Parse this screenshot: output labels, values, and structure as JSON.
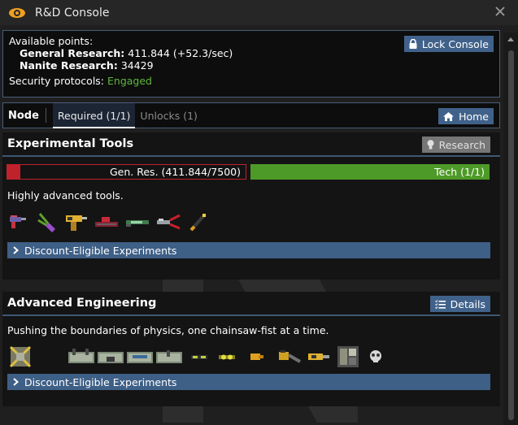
{
  "window": {
    "title": "R&D Console"
  },
  "points": {
    "available_label": "Available points:",
    "general_label": "General Research:",
    "general_value": "411.844 (+52.3/sec)",
    "nanite_label": "Nanite Research:",
    "nanite_value": "34429",
    "security_label": "Security protocols:",
    "security_value": "Engaged",
    "lock_button": "Lock Console"
  },
  "tabs": {
    "node_label": "Node",
    "required": "Required (1/1)",
    "unlocks": "Unlocks (1)",
    "home_button": "Home"
  },
  "nodes": [
    {
      "name": "Experimental Tools",
      "button": "Research",
      "gen_bar_label": "Gen. Res. (411.844/7500)",
      "gen_progress": 0.055,
      "tech_bar_label": "Tech (1/1)",
      "tech_progress": 1.0,
      "description": "Highly advanced tools.",
      "experiments": "Discount-Eligible Experiments",
      "item_icons": [
        "rcd-gun-icon",
        "wirecutter-icon",
        "power-drill-icon",
        "rapid-pipe-dispenser-icon",
        "plasma-cutter-icon",
        "jaws-of-life-icon",
        "welding-tool-icon"
      ]
    },
    {
      "name": "Advanced Engineering",
      "button": "Details",
      "description": "Pushing the boundaries of physics, one chainsaw-fist at a time.",
      "experiments": "Discount-Eligible Experiments",
      "item_icons": [
        "engineering-module-icon",
        "toolbelt-icon",
        "toolbelt-icon",
        "toolbelt-icon",
        "toolbelt-icon",
        "meson-goggles-icon",
        "weld-goggles-icon",
        "yellow-glove-icon",
        "chainsaw-icon",
        "drill-icon",
        "machine-board-icon",
        "skull-mask-icon"
      ]
    }
  ],
  "colors": {
    "accent": "#40628a",
    "engaged": "#5fb83e",
    "progress_red": "#c0222b",
    "progress_green": "#4e9a28"
  }
}
